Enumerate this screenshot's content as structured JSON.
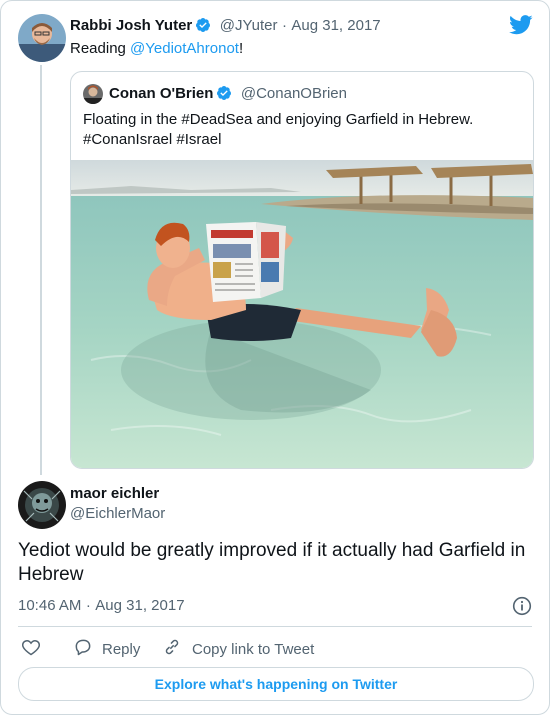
{
  "tweet": {
    "author_name": "Rabbi Josh Yuter",
    "author_handle": "@JYuter",
    "separator": "·",
    "date": "Aug 31, 2017",
    "text_prefix": "Reading ",
    "mention": "@YediotAhronot",
    "text_suffix": "!"
  },
  "quoted": {
    "author_name": "Conan O'Brien",
    "author_handle": "@ConanOBrien",
    "line1": "Floating in the #DeadSea and enjoying Garfield in Hebrew.",
    "line2": "#ConanIsrael #Israel"
  },
  "reply": {
    "author_name": "maor eichler",
    "author_handle": "@EichlerMaor",
    "text": "Yediot would be greatly improved if it actually had Garfield in Hebrew",
    "time": "10:46 AM",
    "separator": "·",
    "date": "Aug 31, 2017"
  },
  "actions": {
    "reply_label": "Reply",
    "copy_label": "Copy link to Tweet",
    "explore_label": "Explore what's happening on Twitter"
  },
  "icons": {
    "brand": "twitter-bird-icon",
    "verified": "verified-badge-icon",
    "info": "info-icon",
    "like": "heart-icon",
    "reply": "reply-bubble-icon",
    "copy": "link-icon"
  },
  "colors": {
    "accent": "#1d9bf0",
    "text": "#0f1419",
    "muted": "#536471",
    "border": "#cfd9de"
  }
}
